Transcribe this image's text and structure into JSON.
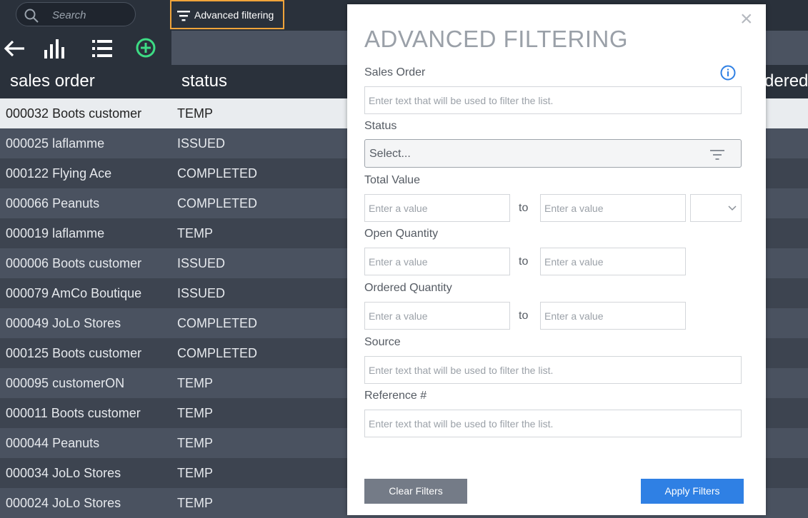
{
  "topbar": {
    "search_placeholder": "Search",
    "advanced_button_label": "Advanced filtering",
    "highlight_color": "#f0a43a"
  },
  "toolbar": {
    "icons": [
      "back-arrow-icon",
      "bar-chart-icon",
      "list-icon",
      "add-circle-icon"
    ],
    "add_color": "#3ddc84"
  },
  "table": {
    "columns": [
      "sales order",
      "status",
      "dered"
    ],
    "rows": [
      {
        "order": "000032 Boots customer",
        "status": "TEMP"
      },
      {
        "order": "000025 laflamme",
        "status": "ISSUED"
      },
      {
        "order": "000122 Flying Ace",
        "status": "COMPLETED"
      },
      {
        "order": "000066 Peanuts",
        "status": "COMPLETED"
      },
      {
        "order": "000019 laflamme",
        "status": "TEMP"
      },
      {
        "order": "000006 Boots customer",
        "status": "ISSUED"
      },
      {
        "order": "000079 AmCo Boutique",
        "status": "ISSUED"
      },
      {
        "order": "000049 JoLo Stores",
        "status": "COMPLETED"
      },
      {
        "order": "000125 Boots customer",
        "status": "COMPLETED"
      },
      {
        "order": "000095 customerON",
        "status": "TEMP"
      },
      {
        "order": "000011 Boots customer",
        "status": "TEMP"
      },
      {
        "order": "000044 Peanuts",
        "status": "TEMP"
      },
      {
        "order": "000034 JoLo Stores",
        "status": "TEMP"
      },
      {
        "order": "000024 JoLo Stores",
        "status": "TEMP"
      }
    ]
  },
  "modal": {
    "title": "ADVANCED FILTERING",
    "close_symbol": "×",
    "sales_order_label": "Sales Order",
    "text_placeholder": "Enter text that will be used to filter the list.",
    "status_label": "Status",
    "status_select": "Select...",
    "total_value_label": "Total Value",
    "open_quantity_label": "Open Quantity",
    "ordered_quantity_label": "Ordered Quantity",
    "value_placeholder": "Enter a value",
    "to_label": "to",
    "source_label": "Source",
    "reference_label": "Reference #",
    "clear_label": "Clear Filters",
    "apply_label": "Apply Filters",
    "info_color": "#2f80e4"
  }
}
